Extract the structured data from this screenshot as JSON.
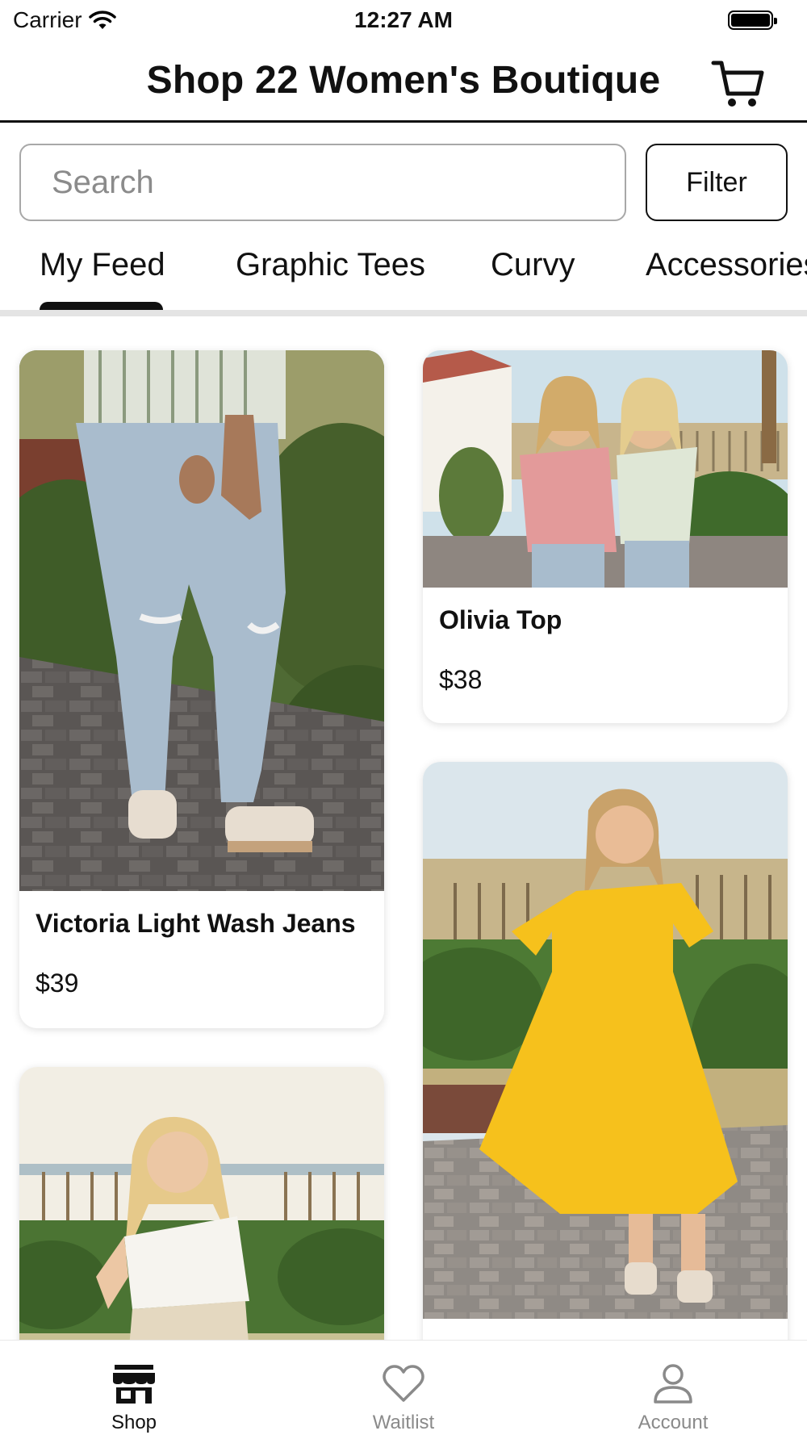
{
  "status_bar": {
    "carrier": "Carrier",
    "time": "12:27 AM"
  },
  "header": {
    "title": "Shop 22 Women's Boutique",
    "cart_icon": "cart-icon"
  },
  "search": {
    "placeholder": "Search",
    "value": "",
    "filter_label": "Filter"
  },
  "tabs": [
    {
      "label": "My Feed",
      "selected": true
    },
    {
      "label": "Graphic Tees",
      "selected": false
    },
    {
      "label": "Curvy",
      "selected": false
    },
    {
      "label": "Accessories",
      "selected": false
    }
  ],
  "products": [
    {
      "name": "Victoria Light Wash Jeans",
      "price": "$39"
    },
    {
      "name": "Olivia Top",
      "price": "$38"
    },
    {
      "name": "",
      "price": ""
    },
    {
      "name": "",
      "price": ""
    }
  ],
  "tabbar": [
    {
      "label": "Shop",
      "icon": "store-icon",
      "active": true
    },
    {
      "label": "Waitlist",
      "icon": "heart-icon",
      "active": false
    },
    {
      "label": "Account",
      "icon": "person-icon",
      "active": false
    }
  ],
  "colors": {
    "accent": "#111111",
    "inactive": "#8a8a8a",
    "divider": "#e4e4e4"
  }
}
